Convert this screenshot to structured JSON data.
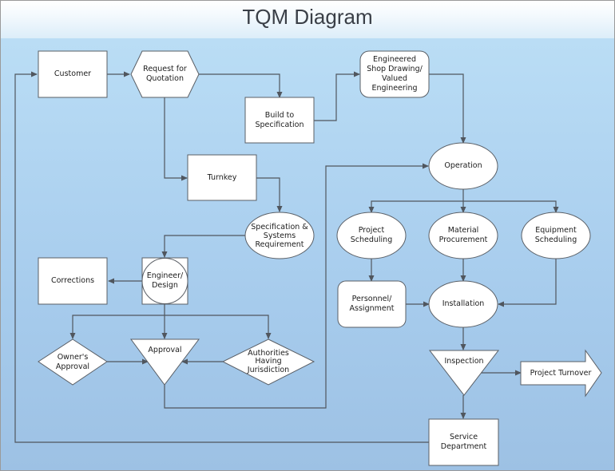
{
  "title": "TQM Diagram",
  "colors": {
    "shape_fill": "#ffffff",
    "shape_stroke": "#5a5f66",
    "connector": "#50565e",
    "background_top": "#bde0f6",
    "background_bottom": "#9dc1e4"
  },
  "nodes": {
    "customer": {
      "label": "Customer",
      "shape": "rectangle"
    },
    "request_for_quotation": {
      "label": "Request for\nQuotation",
      "shape": "hexagon"
    },
    "build_to_specification": {
      "label": "Build to\nSpecification",
      "shape": "rectangle"
    },
    "engineered_shop_drawing": {
      "label": "Engineered\nShop Drawing/\nValued\nEngineering",
      "shape": "rounded-rectangle"
    },
    "turnkey": {
      "label": "Turnkey",
      "shape": "rectangle"
    },
    "specification_systems": {
      "label": "Specification &\nSystems\nRequirement",
      "shape": "ellipse"
    },
    "operation": {
      "label": "Operation",
      "shape": "ellipse"
    },
    "corrections": {
      "label": "Corrections",
      "shape": "rectangle"
    },
    "engineer_design": {
      "label": "Engineer/\nDesign",
      "shape": "circle-in-square"
    },
    "project_scheduling": {
      "label": "Project\nScheduling",
      "shape": "ellipse"
    },
    "material_procurement": {
      "label": "Material\nProcurement",
      "shape": "ellipse"
    },
    "equipment_scheduling": {
      "label": "Equipment\nScheduling",
      "shape": "ellipse"
    },
    "personnel_assignment": {
      "label": "Personnel/\nAssignment",
      "shape": "rounded-rectangle"
    },
    "installation": {
      "label": "Installation",
      "shape": "ellipse"
    },
    "owners_approval": {
      "label": "Owner's\nApproval",
      "shape": "diamond"
    },
    "approval": {
      "label": "Approval",
      "shape": "inverted-triangle"
    },
    "authorities": {
      "label": "Authorities\nHaving\nJurisdiction",
      "shape": "diamond"
    },
    "inspection": {
      "label": "Inspection",
      "shape": "inverted-triangle"
    },
    "project_turnover": {
      "label": "Project Turnover",
      "shape": "arrow"
    },
    "service_department": {
      "label": "Service\nDepartment",
      "shape": "rectangle"
    }
  },
  "edges": [
    [
      "customer",
      "request_for_quotation"
    ],
    [
      "request_for_quotation",
      "build_to_specification"
    ],
    [
      "request_for_quotation",
      "turnkey"
    ],
    [
      "build_to_specification",
      "engineered_shop_drawing"
    ],
    [
      "engineered_shop_drawing",
      "operation"
    ],
    [
      "turnkey",
      "specification_systems"
    ],
    [
      "specification_systems",
      "engineer_design"
    ],
    [
      "engineer_design",
      "corrections"
    ],
    [
      "engineer_design",
      "owners_approval"
    ],
    [
      "engineer_design",
      "approval"
    ],
    [
      "engineer_design",
      "authorities"
    ],
    [
      "owners_approval",
      "approval"
    ],
    [
      "authorities",
      "approval"
    ],
    [
      "approval",
      "operation"
    ],
    [
      "operation",
      "project_scheduling"
    ],
    [
      "operation",
      "material_procurement"
    ],
    [
      "operation",
      "equipment_scheduling"
    ],
    [
      "project_scheduling",
      "personnel_assignment"
    ],
    [
      "personnel_assignment",
      "installation"
    ],
    [
      "material_procurement",
      "installation"
    ],
    [
      "equipment_scheduling",
      "installation"
    ],
    [
      "installation",
      "inspection"
    ],
    [
      "inspection",
      "project_turnover"
    ],
    [
      "inspection",
      "service_department"
    ],
    [
      "service_department",
      "customer"
    ]
  ]
}
